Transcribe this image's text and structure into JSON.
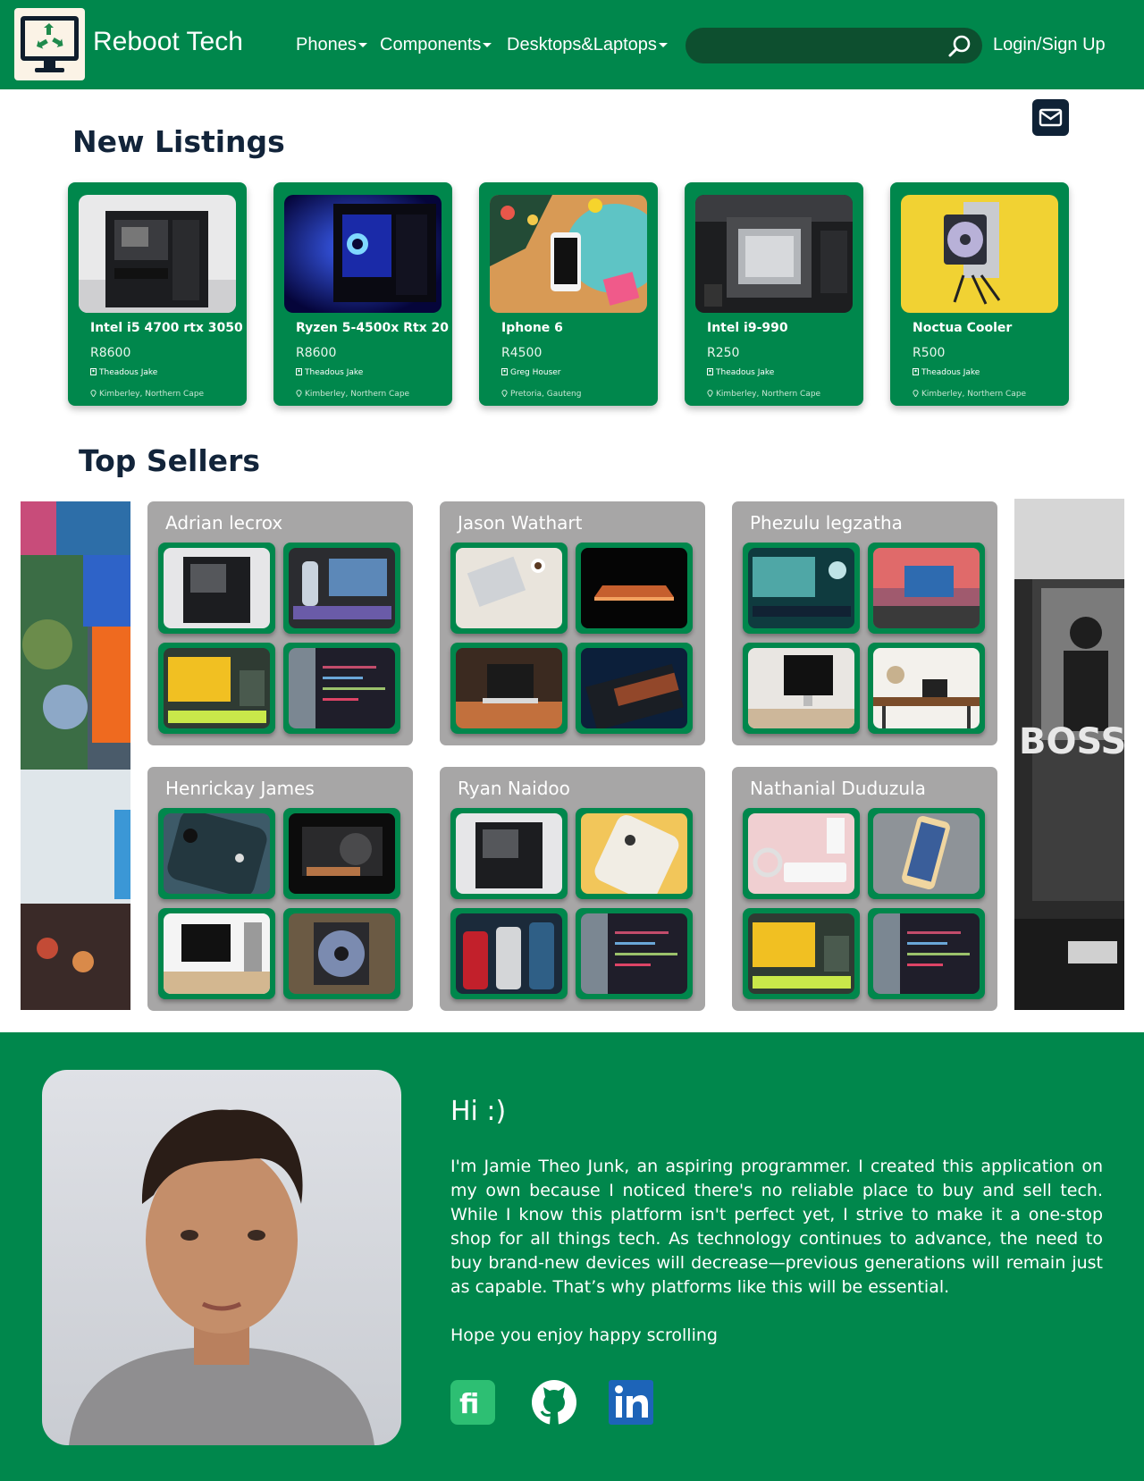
{
  "header": {
    "brand": "Reboot Tech",
    "nav": [
      {
        "label": "Phones"
      },
      {
        "label": "Components"
      },
      {
        "label": "Desktops&Laptops"
      }
    ],
    "search": {
      "placeholder": "",
      "value": ""
    },
    "login_label": "Login/Sign Up",
    "brand_color": "#00874c"
  },
  "new_listings": {
    "title": "New Listings",
    "items": [
      {
        "title": "Intel i5 4700 rtx 3050",
        "price": "R8600",
        "seller": "Theadous Jake",
        "location": "Kimberley, Northern Cape",
        "image": "open-pc-case-image"
      },
      {
        "title": "Ryzen 5-4500x Rtx 20",
        "price": "R8600",
        "seller": "Theadous Jake",
        "location": "Kimberley, Northern Cape",
        "image": "blue-lit-pc-image"
      },
      {
        "title": "Iphone 6",
        "price": "R4500",
        "seller": "Greg Houser",
        "location": "Pretoria, Gauteng",
        "image": "phone-on-desk-image"
      },
      {
        "title": "Intel i9-990",
        "price": "R250",
        "seller": "Theadous Jake",
        "location": "Kimberley, Northern Cape",
        "image": "cpu-in-socket-image"
      },
      {
        "title": "Noctua Cooler",
        "price": "R500",
        "seller": "Theadous Jake",
        "location": "Kimberley, Northern Cape",
        "image": "cpu-cooler-image"
      }
    ]
  },
  "top_sellers": {
    "title": "Top Sellers",
    "sellers": [
      {
        "name": "Adrian lecrox"
      },
      {
        "name": "Jason Wathart"
      },
      {
        "name": "Phezulu legzatha"
      },
      {
        "name": "Henrickay James"
      },
      {
        "name": "Ryan Naidoo"
      },
      {
        "name": "Nathanial Duduzula"
      }
    ],
    "banner_text": "BOSS"
  },
  "about": {
    "greeting": "Hi :)",
    "bio": "I'm Jamie Theo Junk, an aspiring programmer. I created this application on my own because I noticed there's no reliable place to buy and sell tech. While I know this platform isn't perfect yet, I strive to make it a one-stop shop for all things tech. As technology continues to advance, the need to buy brand-new devices will decrease—previous generations will remain just as capable. That’s why platforms like this will be essential.",
    "closing": "Hope you enjoy happy scrolling",
    "socials": [
      "fi-icon",
      "github-icon",
      "linkedin-icon"
    ]
  }
}
